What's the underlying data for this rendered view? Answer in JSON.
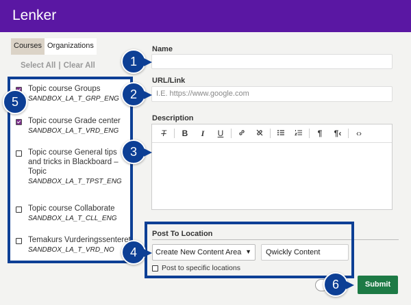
{
  "header": {
    "title": "Lenker"
  },
  "tabs": [
    {
      "label": "Courses"
    },
    {
      "label": "Organizations"
    }
  ],
  "selection": {
    "select_all": "Select All",
    "separator": "|",
    "clear_all": "Clear All"
  },
  "courses": [
    {
      "name": "Topic course Groups",
      "id": "SANDBOX_LA_T_GRP_ENG",
      "checked": true
    },
    {
      "name": "Topic course Grade center",
      "id": "SANDBOX_LA_T_VRD_ENG",
      "checked": true
    },
    {
      "name": "Topic course General tips and tricks in Blackboard – Topic",
      "id": "SANDBOX_LA_T_TPST_ENG",
      "checked": false
    },
    {
      "name": "Topic course Collaborate",
      "id": "SANDBOX_LA_T_CLL_ENG",
      "checked": false
    },
    {
      "name": "Temakurs Vurderingssenteret",
      "id": "SANDBOX_LA_T_VRD_NO",
      "checked": false
    }
  ],
  "form": {
    "name_label": "Name",
    "name_value": "",
    "url_label": "URL/Link",
    "url_placeholder": "I.E. https://www.google.com",
    "description_label": "Description",
    "toolbar_icons": [
      "clear-format-icon",
      "bold-icon",
      "italic-icon",
      "underline-icon",
      "link-icon",
      "unlink-icon",
      "bullet-list-icon",
      "numbered-list-icon",
      "ltr-icon",
      "rtl-icon",
      "code-icon"
    ]
  },
  "post": {
    "label": "Post To Location",
    "select_value": "Create New Content Area",
    "content_name": "Qwickly Content",
    "specific_label": "Post to specific locations"
  },
  "actions": {
    "submit": "Submit"
  },
  "markers": [
    "1",
    "2",
    "3",
    "4",
    "5",
    "6"
  ],
  "colors": {
    "header": "#5a17a3",
    "callout": "#0d3f95",
    "submit": "#1d7a45"
  }
}
